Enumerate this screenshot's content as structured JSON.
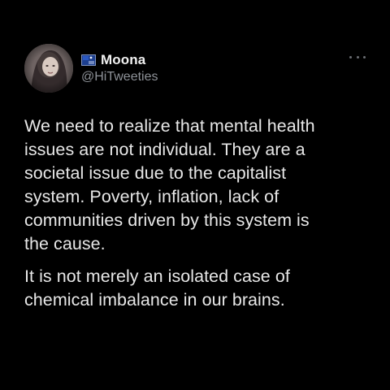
{
  "tweet": {
    "author": {
      "display_name": "Moona",
      "handle": "@HiTweeties",
      "avatar_icon": "user-avatar",
      "badge_icon": "flag-icon"
    },
    "more_icon": "more-horizontal-icon",
    "paragraphs": [
      "We need to realize that mental health\nissues are not individual. They are a\nsocietal issue due to the capitalist\nsystem. Poverty, inflation, lack of\ncommunities driven by this system is\nthe cause.",
      "It is not merely an isolated case of\nchemical imbalance in our brains."
    ]
  },
  "colors": {
    "background": "#000000",
    "text": "#e7e7e7",
    "handle": "#8d9197"
  }
}
